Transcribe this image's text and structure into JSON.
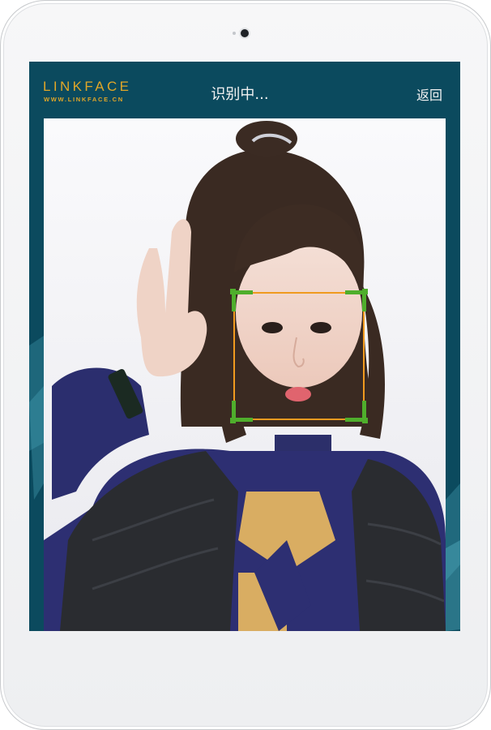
{
  "brand": {
    "name": "LINKFACE",
    "url": "WWW.LINKFACE.CN"
  },
  "header": {
    "title": "识别中...",
    "back_label": "返回"
  },
  "colors": {
    "screen_bg": "#0b4a5e",
    "brand_accent": "#e0a628",
    "face_box": "#f09a1f",
    "face_corners": "#4fae2c"
  },
  "preview": {
    "content": "camera-feed-photo"
  }
}
